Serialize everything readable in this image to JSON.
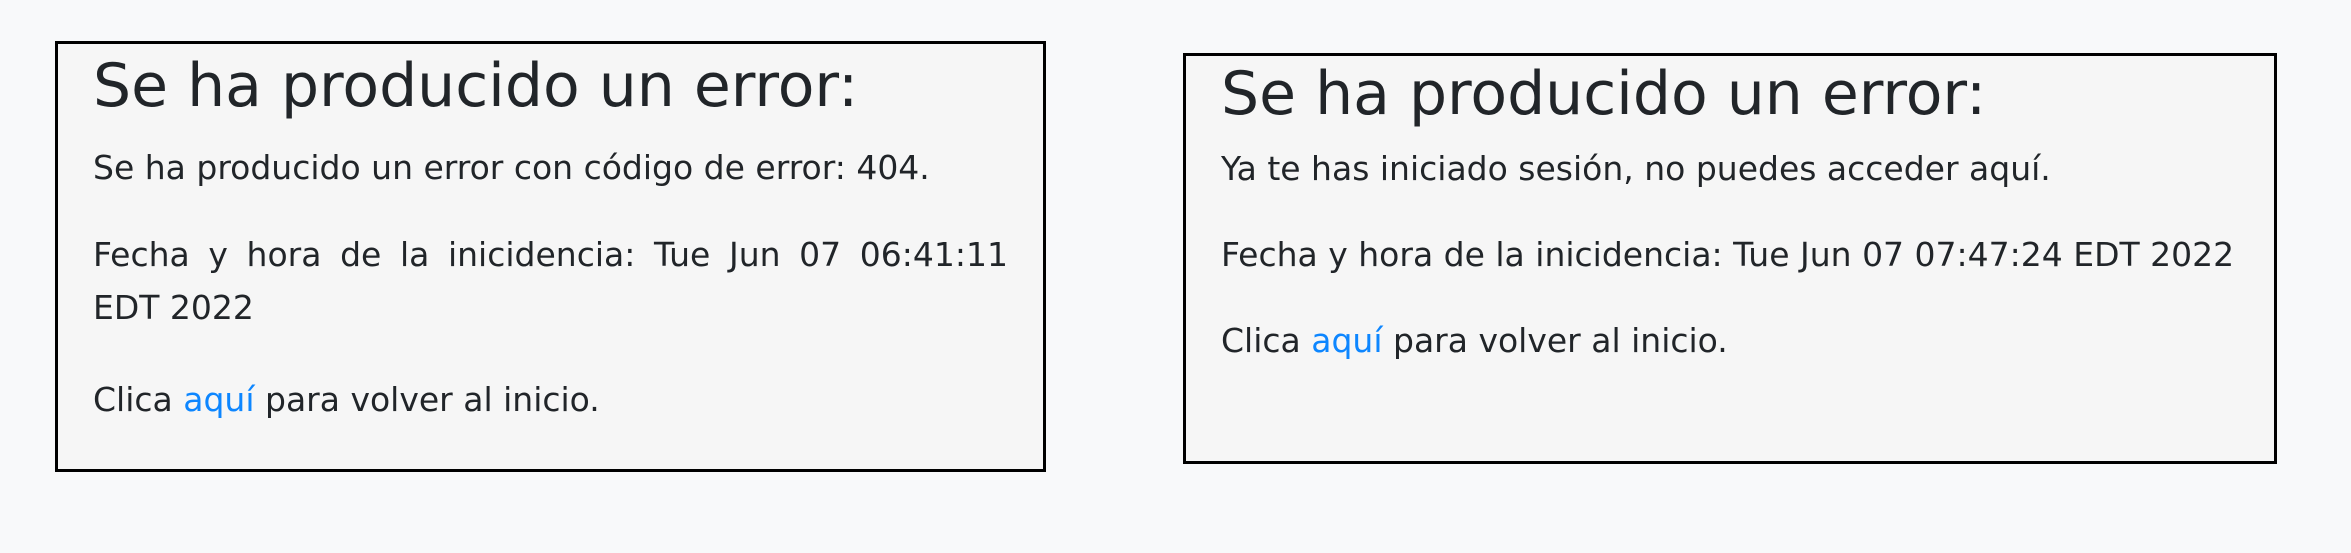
{
  "panels": [
    {
      "title": "Se ha producido un error:",
      "message": "Se ha producido un error con código de error: 404.",
      "date_label": "Fecha y hora de la inicidencia:",
      "date_value": "Tue Jun 07 06:41:11 EDT 2022",
      "return_prefix": "Clica",
      "return_link": "aquí",
      "return_suffix": "para volver al inicio."
    },
    {
      "title": "Se ha producido un error:",
      "message": "Ya te has iniciado sesión, no puedes acceder aquí.",
      "date_label": "Fecha y hora de la inicidencia:",
      "date_value": "Tue Jun 07 07:47:24 EDT 2022",
      "return_prefix": "Clica",
      "return_link": "aquí",
      "return_suffix": "para volver al inicio."
    }
  ],
  "colors": {
    "link": "#0d86ff",
    "panel_background": "#f6f6f6",
    "page_background": "#f8f9fa"
  }
}
